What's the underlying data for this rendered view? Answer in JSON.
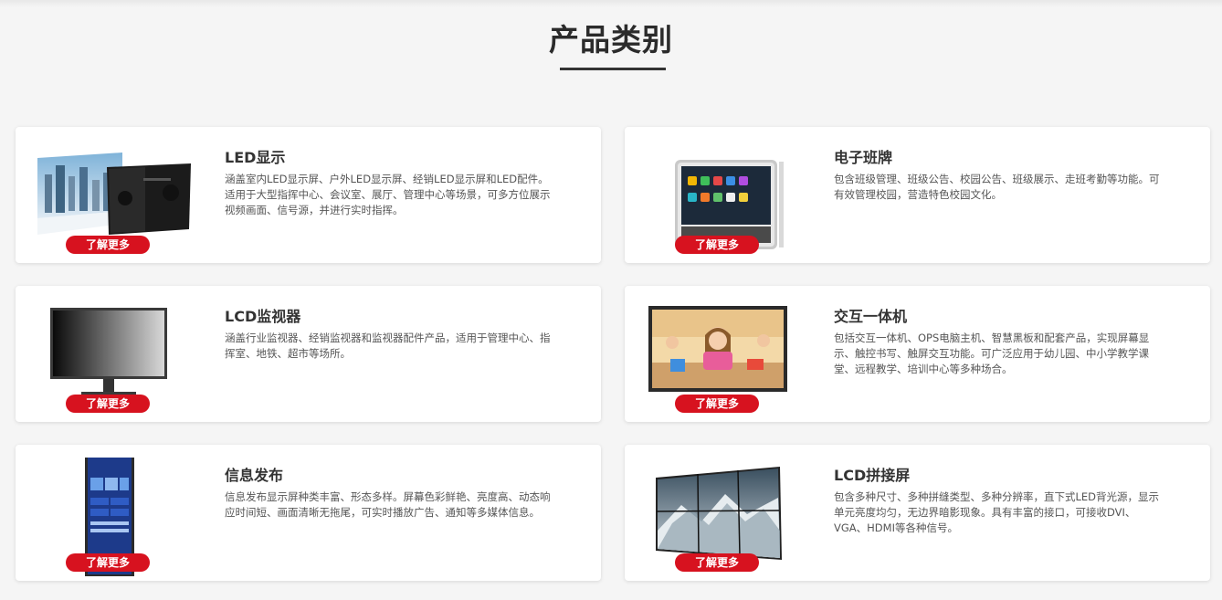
{
  "page": {
    "title": "产品类别"
  },
  "categories": [
    {
      "title": "LED显示",
      "desc": "涵盖室内LED显示屏、户外LED显示屏、经销LED显示屏和LED配件。适用于大型指挥中心、会议室、展厅、管理中心等场景，可多方位展示视频画面、信号源，并进行实时指挥。",
      "button": "了解更多",
      "image": "led-display-image"
    },
    {
      "title": "电子班牌",
      "desc": "包含班级管理、班级公告、校园公告、班级展示、走班考勤等功能。可有效管理校园，营造特色校园文化。",
      "button": "了解更多",
      "image": "class-board-image"
    },
    {
      "title": "LCD监视器",
      "desc": "涵盖行业监视器、经销监视器和监视器配件产品，适用于管理中心、指挥室、地铁、超市等场所。",
      "button": "了解更多",
      "image": "lcd-monitor-image"
    },
    {
      "title": "交互一体机",
      "desc": "包括交互一体机、OPS电脑主机、智慧黑板和配套产品，实现屏幕显示、触控书写、触屏交互功能。可广泛应用于幼儿园、中小学教学课堂、远程教学、培训中心等多种场合。",
      "button": "了解更多",
      "image": "interactive-display-image"
    },
    {
      "title": "信息发布",
      "desc": "信息发布显示屏种类丰富、形态多样。屏幕色彩鲜艳、亮度高、动态响应时间短、画面清晰无拖尾，可实时播放广告、通知等多媒体信息。",
      "button": "了解更多",
      "image": "signage-kiosk-image"
    },
    {
      "title": "LCD拼接屏",
      "desc": "包含多种尺寸、多种拼缝类型、多种分辨率，直下式LED背光源，显示单元亮度均匀，无边界暗影现象。具有丰富的接口，可接收DVI、VGA、HDMI等各种信号。",
      "button": "了解更多",
      "image": "video-wall-image"
    }
  ],
  "colors": {
    "accent": "#d7121f",
    "background": "#f5f5f5",
    "card": "#ffffff"
  }
}
